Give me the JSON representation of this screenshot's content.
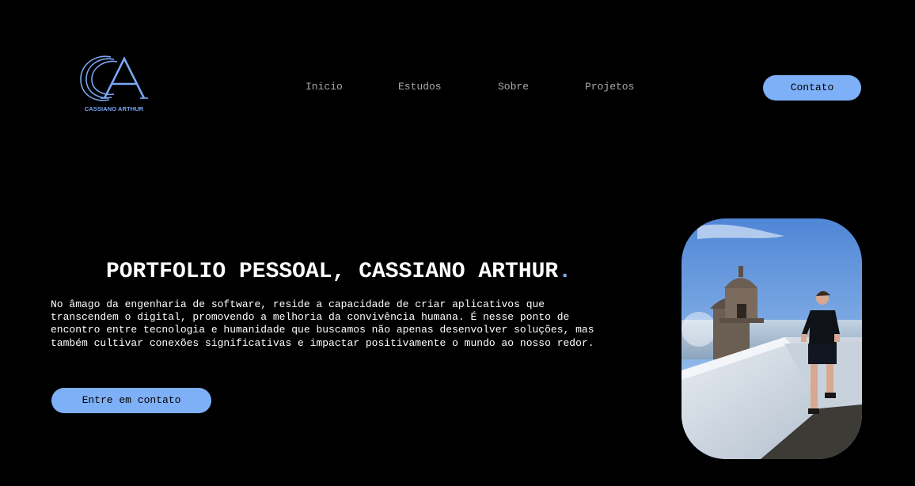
{
  "header": {
    "logo_text": "CASSIANO ARTHUR",
    "nav": [
      "Inicio",
      "Estudos",
      "Sobre",
      "Projetos"
    ],
    "contact_label": "Contato"
  },
  "hero": {
    "title": "PORTFOLIO PESSOAL, CASSIANO ARTHUR",
    "title_dot": ".",
    "description": "No âmago da engenharia de software, reside a capacidade de criar aplicativos que transcendem o digital, promovendo a melhoria da convivência humana. É nesse ponto de encontro entre tecnologia e humanidade que buscamos não apenas desenvolver soluções, mas também cultivar conexões significativas e impactar positivamente o mundo ao nosso redor.",
    "cta_label": "Entre em contato"
  },
  "colors": {
    "background": "#000000",
    "accent": "#7eb0f7",
    "nav_text": "#a9a9a9"
  }
}
